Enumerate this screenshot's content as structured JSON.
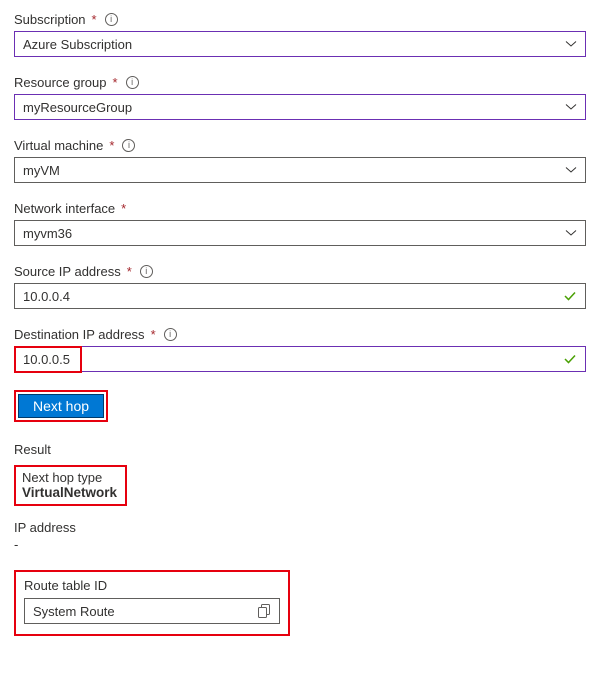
{
  "fields": {
    "subscription": {
      "label": "Subscription",
      "value": "Azure Subscription"
    },
    "resourceGroup": {
      "label": "Resource group",
      "value": "myResourceGroup"
    },
    "virtualMachine": {
      "label": "Virtual machine",
      "value": "myVM"
    },
    "networkInterface": {
      "label": "Network interface",
      "value": "myvm36"
    },
    "sourceIp": {
      "label": "Source IP address",
      "value": "10.0.0.4"
    },
    "destIp": {
      "label": "Destination IP address",
      "value": "10.0.0.5"
    }
  },
  "button": {
    "nextHop": "Next hop"
  },
  "result": {
    "heading": "Result",
    "hopTypeLabel": "Next hop type",
    "hopTypeValue": "VirtualNetwork",
    "ipLabel": "IP address",
    "ipValue": "-",
    "routeLabel": "Route table ID",
    "routeValue": "System Route"
  }
}
